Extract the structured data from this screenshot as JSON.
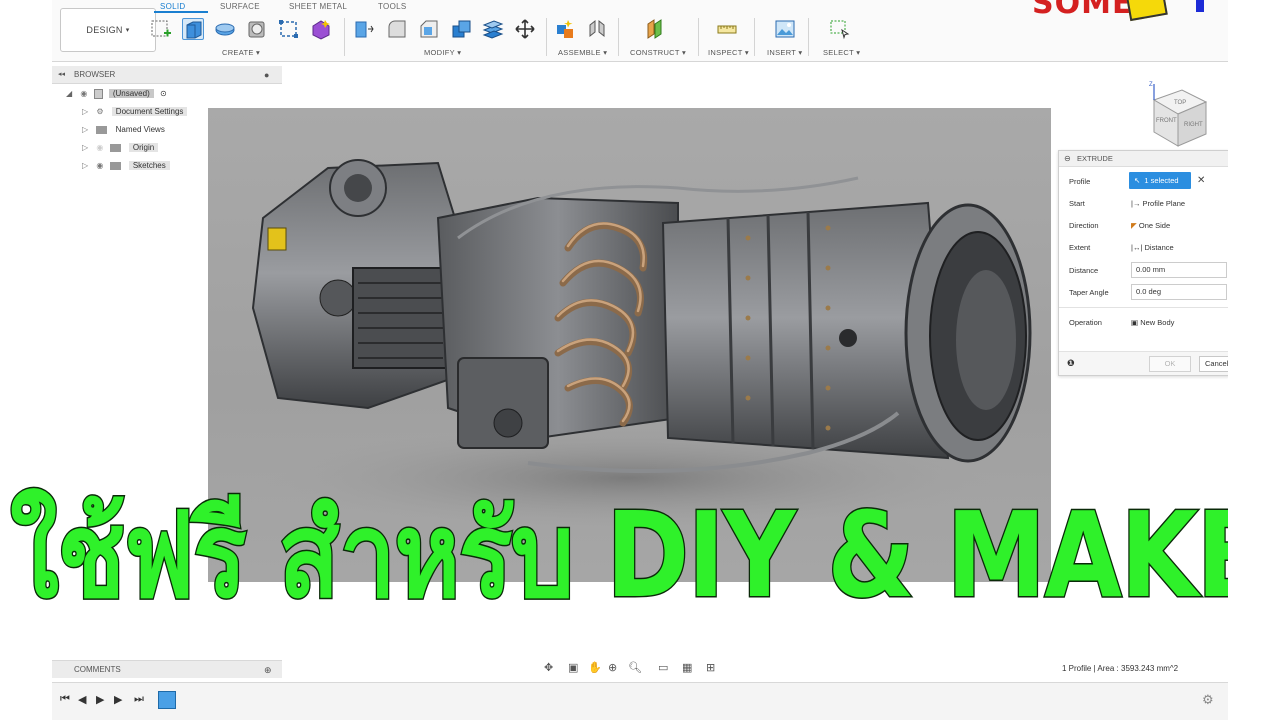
{
  "toolbar": {
    "workspace": "DESIGN",
    "tabs": [
      "SOLID",
      "SURFACE",
      "SHEET METAL",
      "TOOLS"
    ],
    "groups": [
      "CREATE",
      "MODIFY",
      "ASSEMBLE",
      "CONSTRUCT",
      "INSPECT",
      "INSERT",
      "SELECT"
    ]
  },
  "logo": {
    "text": "SOME"
  },
  "browser": {
    "title": "BROWSER",
    "items": [
      {
        "label": "(Unsaved)"
      },
      {
        "label": "Document Settings"
      },
      {
        "label": "Named Views"
      },
      {
        "label": "Origin"
      },
      {
        "label": "Sketches"
      }
    ]
  },
  "extrude": {
    "title": "EXTRUDE",
    "rows": [
      {
        "label": "Profile",
        "value": "1 selected"
      },
      {
        "label": "Start",
        "value": "Profile Plane"
      },
      {
        "label": "Direction",
        "value": "One Side"
      },
      {
        "label": "Extent",
        "value": "Distance"
      },
      {
        "label": "Distance",
        "value": "0.00 mm"
      },
      {
        "label": "Taper Angle",
        "value": "0.0 deg"
      },
      {
        "label": "Operation",
        "value": "New Body"
      }
    ],
    "ok": "OK",
    "cancel": "Cancel"
  },
  "headline": "ใช้ฟรี สำหรับ DIY & MAKER",
  "comments": "COMMENTS",
  "status": "1 Profile | Area : 3593.243 mm^2",
  "viewcube": {
    "top": "TOP",
    "front": "FRONT",
    "right": "RIGHT"
  }
}
